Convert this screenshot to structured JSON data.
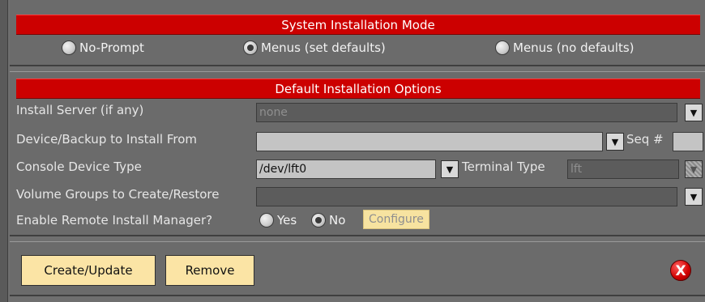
{
  "install_mode": {
    "title": "System Installation Mode",
    "options": [
      {
        "label": "No-Prompt",
        "selected": false
      },
      {
        "label": "Menus (set defaults)",
        "selected": true
      },
      {
        "label": "Menus (no defaults)",
        "selected": false
      }
    ]
  },
  "default_options": {
    "title": "Default Installation Options",
    "install_server": {
      "label": "Install Server (if any)",
      "value": "none"
    },
    "device_backup": {
      "label": "Device/Backup to Install From",
      "value": "",
      "seq_label": "Seq #",
      "seq_value": ""
    },
    "console_device": {
      "label": "Console Device Type",
      "value": "/dev/lft0",
      "terminal_label": "Terminal Type",
      "terminal_value": "lft"
    },
    "volume_groups": {
      "label": "Volume Groups to Create/Restore",
      "value": ""
    },
    "remote_manager": {
      "label": "Enable Remote Install Manager?",
      "yes_label": "Yes",
      "no_label": "No",
      "selected": "No",
      "configure_label": "Configure"
    }
  },
  "actions": {
    "create_update": "Create/Update",
    "remove": "Remove",
    "close_glyph": "X"
  },
  "colors": {
    "header_red": "#cc0000",
    "button_yellow": "#fbe4a5",
    "panel_gray": "#6b6b6b"
  }
}
